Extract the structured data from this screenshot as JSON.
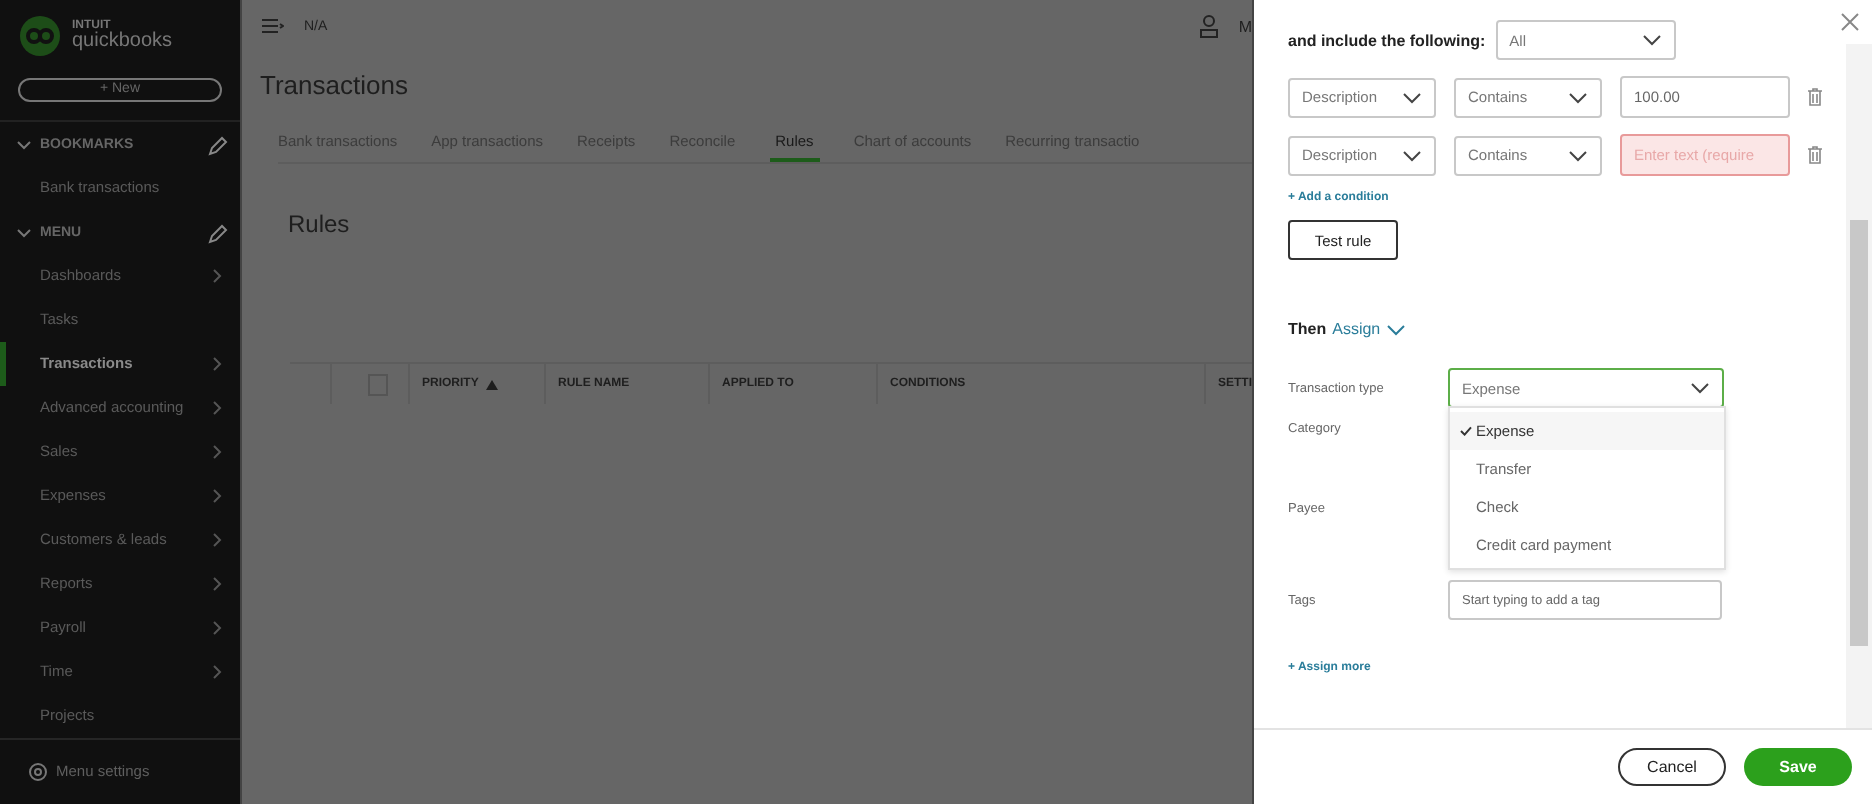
{
  "sidebar": {
    "logo_top": "INTUIT",
    "logo_bottom": "quickbooks",
    "new_button": "+ New",
    "sections": [
      {
        "title": "BOOKMARKS",
        "expanded": true,
        "items": [
          {
            "label": "Bank transactions",
            "selected": false,
            "submenu": false
          }
        ]
      },
      {
        "title": "MENU",
        "expanded": true,
        "items": [
          {
            "label": "Dashboards",
            "selected": false,
            "submenu": true
          },
          {
            "label": "Tasks",
            "selected": false,
            "submenu": false
          },
          {
            "label": "Transactions",
            "selected": true,
            "submenu": true
          },
          {
            "label": "Advanced accounting",
            "selected": false,
            "submenu": true
          },
          {
            "label": "Sales",
            "selected": false,
            "submenu": true
          },
          {
            "label": "Expenses",
            "selected": false,
            "submenu": true
          },
          {
            "label": "Customers & leads",
            "selected": false,
            "submenu": true
          },
          {
            "label": "Reports",
            "selected": false,
            "submenu": true
          },
          {
            "label": "Payroll",
            "selected": false,
            "submenu": true
          },
          {
            "label": "Time",
            "selected": false,
            "submenu": true
          },
          {
            "label": "Projects",
            "selected": false,
            "submenu": false
          }
        ]
      }
    ],
    "settings": "Menu settings"
  },
  "topbar": {
    "company": "N/A",
    "user": "M"
  },
  "page": {
    "title": "Transactions",
    "tabs": [
      {
        "label": "Bank transactions",
        "selected": false
      },
      {
        "label": "App transactions",
        "selected": false
      },
      {
        "label": "Receipts",
        "selected": false
      },
      {
        "label": "Reconcile",
        "selected": false
      },
      {
        "label": "Rules",
        "selected": true
      },
      {
        "label": "Chart of accounts",
        "selected": false
      },
      {
        "label": "Recurring transactio",
        "selected": false
      }
    ],
    "section_title": "Rules",
    "table": {
      "select_all_checked": false,
      "columns": [
        "PRIORITY",
        "RULE NAME",
        "APPLIED TO",
        "CONDITIONS",
        "SETTI"
      ]
    }
  },
  "panel": {
    "include_label": "and include the following:",
    "include_value": "All",
    "conditions": [
      {
        "field": "Description",
        "operator": "Contains",
        "value": "100.00",
        "error": false
      },
      {
        "field": "Description",
        "operator": "Contains",
        "placeholder": "Enter text (require",
        "error": true
      }
    ],
    "add_condition": "+ Add a condition",
    "test_button": "Test rule",
    "then": "Then",
    "assign": "Assign",
    "assign_rows": [
      {
        "label": "Transaction type",
        "kind": "select",
        "value": "Expense",
        "focused": true
      },
      {
        "label": "Category",
        "kind": "hidden"
      },
      {
        "label": "Payee",
        "kind": "hidden"
      },
      {
        "label": "Tags",
        "kind": "text",
        "placeholder": "Start typing to add a tag",
        "focused": false
      }
    ],
    "dropdown": [
      {
        "label": "Expense",
        "selected": true
      },
      {
        "label": "Transfer",
        "selected": false
      },
      {
        "label": "Check",
        "selected": false
      },
      {
        "label": "Credit card payment",
        "selected": false
      }
    ],
    "assign_more": "+ Assign more",
    "buttons": [
      {
        "label": "Cancel",
        "kind": "secondary"
      },
      {
        "label": "Save",
        "kind": "primary"
      }
    ]
  }
}
